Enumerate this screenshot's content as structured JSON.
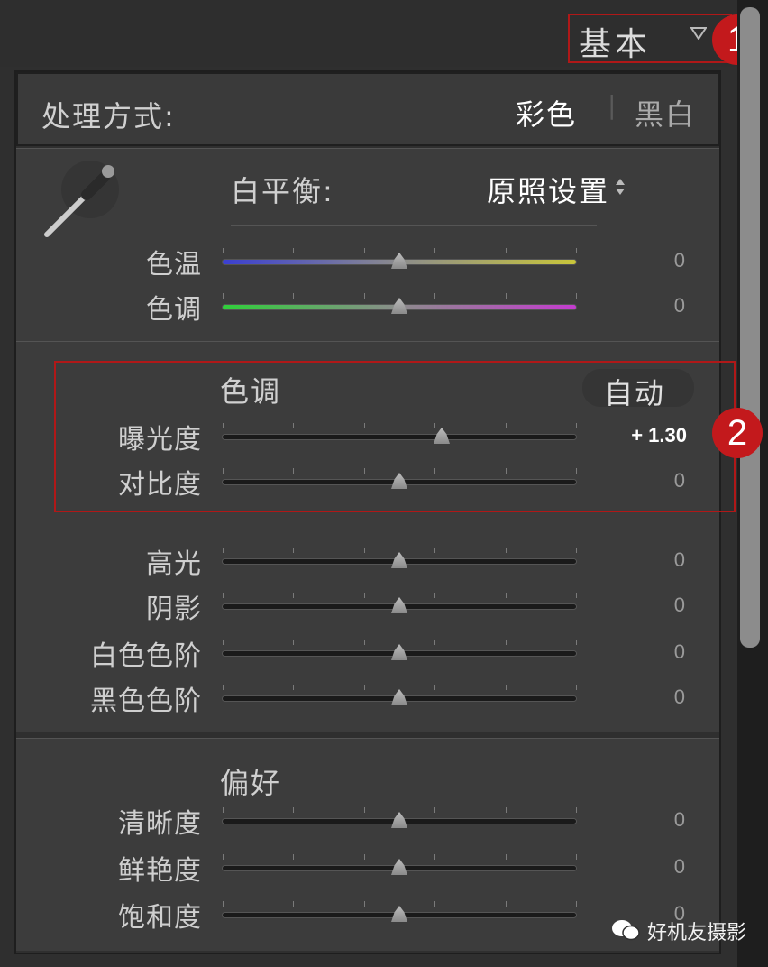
{
  "panel": {
    "title": "基本",
    "collapse_icon": "triangle-down-icon",
    "annotation_1": "1",
    "annotation_2": "2"
  },
  "treatment": {
    "label": "处理方式:",
    "color_option": "彩色",
    "separator": "|",
    "bw_option": "黑白"
  },
  "white_balance": {
    "label": "白平衡:",
    "preset": "原照设置",
    "preset_icon": "up-down-arrows-icon",
    "sliders": [
      {
        "label": "色温",
        "value_text": "0",
        "position": 0.5,
        "gradient": [
          "#3b3fd1",
          "#8c8c8c",
          "#c9c63a"
        ]
      },
      {
        "label": "色调",
        "value_text": "0",
        "position": 0.5,
        "gradient": [
          "#2fcf3a",
          "#8c8c8c",
          "#c43ccf"
        ]
      }
    ]
  },
  "tone": {
    "label": "色调",
    "auto_button": "自动",
    "sliders": [
      {
        "label": "曝光度",
        "value_text": "+ 1.30",
        "position": 0.62
      },
      {
        "label": "对比度",
        "value_text": "0",
        "position": 0.5
      }
    ]
  },
  "tone2": {
    "sliders": [
      {
        "label": "高光",
        "value_text": "0",
        "position": 0.5
      },
      {
        "label": "阴影",
        "value_text": "0",
        "position": 0.5
      },
      {
        "label": "白色色阶",
        "value_text": "0",
        "position": 0.5
      },
      {
        "label": "黑色色阶",
        "value_text": "0",
        "position": 0.5
      }
    ]
  },
  "presence": {
    "label": "偏好",
    "sliders": [
      {
        "label": "清晰度",
        "value_text": "0",
        "position": 0.5
      },
      {
        "label": "鲜艳度",
        "value_text": "0",
        "position": 0.5
      },
      {
        "label": "饱和度",
        "value_text": "0",
        "position": 0.5
      }
    ]
  },
  "watermark": {
    "text": "好机友摄影",
    "icon": "wechat-icon"
  },
  "colors": {
    "panel_bg": "#3c3c3c",
    "annotation_red": "#c3191c",
    "highlight_value": "#ffffff"
  }
}
